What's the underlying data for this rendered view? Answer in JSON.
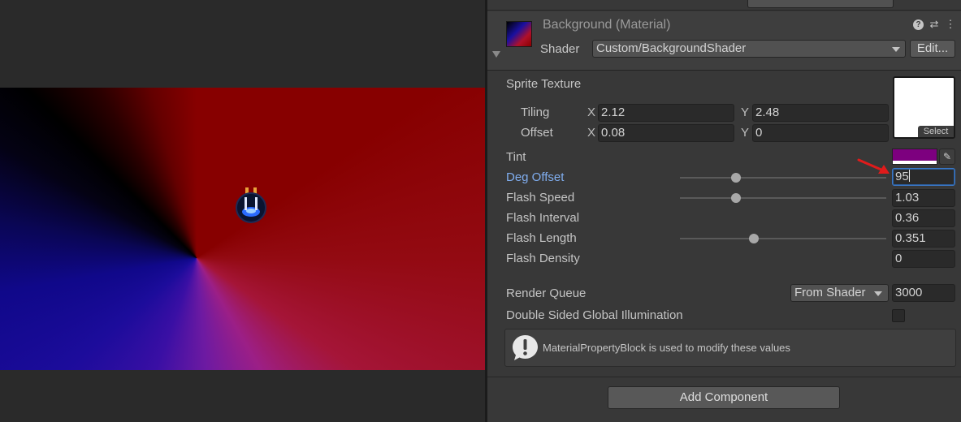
{
  "material": {
    "title": "Background (Material)",
    "shader_label": "Shader",
    "shader_value": "Custom/BackgroundShader",
    "edit_label": "Edit..."
  },
  "properties": {
    "sprite_texture": {
      "label": "Sprite Texture",
      "select_label": "Select",
      "texture_color": "#ffffff"
    },
    "tiling": {
      "label": "Tiling",
      "x_label": "X",
      "x": "2.12",
      "y_label": "Y",
      "y": "2.48"
    },
    "offset": {
      "label": "Offset",
      "x_label": "X",
      "x": "0.08",
      "y_label": "Y",
      "y": "0"
    },
    "tint": {
      "label": "Tint",
      "color": "#7d007f"
    },
    "deg_offset": {
      "label": "Deg Offset",
      "value": "95",
      "slider_fraction": 0.27
    },
    "flash_speed": {
      "label": "Flash Speed",
      "value": "1.03",
      "slider_fraction": 0.27
    },
    "flash_interval": {
      "label": "Flash Interval",
      "value": "0.36"
    },
    "flash_length": {
      "label": "Flash Length",
      "value": "0.351",
      "slider_fraction": 0.36
    },
    "flash_density": {
      "label": "Flash Density",
      "value": "0"
    }
  },
  "render_queue": {
    "label": "Render Queue",
    "mode": "From Shader",
    "value": "3000"
  },
  "double_sided_gi": {
    "label": "Double Sided Global Illumination",
    "checked": false
  },
  "help_box": {
    "icon": "info-icon",
    "text": "MaterialPropertyBlock is used to modify these values"
  },
  "add_component_label": "Add Component",
  "colors": {
    "active_label": "#80aef0",
    "focus_border": "#3a78c8",
    "annotation_arrow": "#e01b1b"
  }
}
